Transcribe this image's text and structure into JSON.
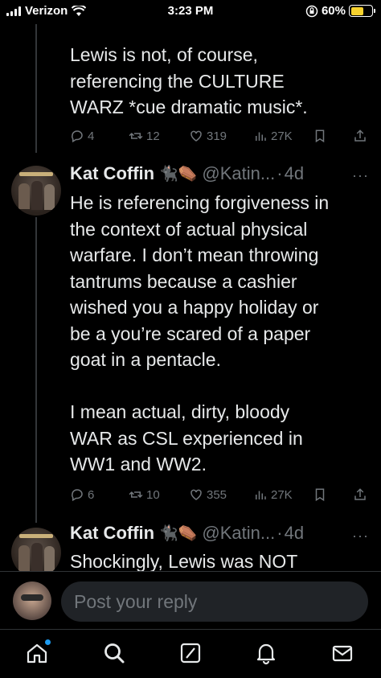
{
  "status_bar": {
    "carrier": "Verizon",
    "time": "3:23 PM",
    "battery_percent": "60%",
    "battery_level": 0.6,
    "battery_color": "#f7d22e"
  },
  "tweets": [
    {
      "text": "Lewis is not, of course,\nreferencing the CULTURE\nWARZ *cue dramatic music*.",
      "metrics": {
        "replies": "4",
        "retweets": "12",
        "likes": "319",
        "views": "27K"
      }
    },
    {
      "author": "Kat Coffin",
      "emojis": "🐈‍⬛⚰️",
      "handle": "@Katin...",
      "dot": "·",
      "time": "4d",
      "text": "He is referencing forgiveness in\nthe context of actual physical\nwarfare. I don’t mean throwing\ntantrums because a cashier\nwished you a happy holiday or\nbe a you’re scared of a paper\ngoat in a pentacle.\n\nI mean actual, dirty, bloody\nWAR as CSL experienced in\nWW1 and WW2.",
      "metrics": {
        "replies": "6",
        "retweets": "10",
        "likes": "355",
        "views": "27K"
      }
    },
    {
      "author": "Kat Coffin",
      "emojis": "🐈‍⬛⚰️",
      "handle": "@Katin...",
      "dot": "·",
      "time": "4d",
      "text": "Shockingly, Lewis was NOT"
    }
  ],
  "reply": {
    "placeholder": "Post your reply"
  },
  "icons": {
    "status": [
      "signal-icon",
      "wifi-icon",
      "orientation-lock-icon",
      "battery-icon"
    ],
    "actions": [
      "reply-icon",
      "retweet-icon",
      "like-icon",
      "views-icon",
      "bookmark-icon",
      "share-icon"
    ],
    "nav": [
      "home-icon",
      "search-icon",
      "grok-icon",
      "notifications-icon",
      "messages-icon"
    ]
  },
  "colors": {
    "accent": "#1d9bf0",
    "muted": "#71767b",
    "text": "#e7e9ea"
  }
}
